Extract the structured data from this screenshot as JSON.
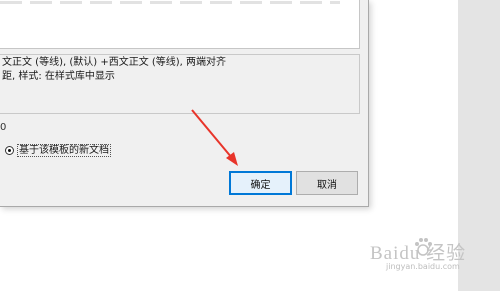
{
  "style_description": {
    "line1": "文正文 (等线), (默认) +西文正文 (等线), 两端对齐",
    "line2": "距, 样式: 在样式库中显示"
  },
  "options": {
    "partial_label": "0",
    "new_docs_radio_label": "基于该模板的新文档",
    "new_docs_radio_checked": true
  },
  "buttons": {
    "ok_label": "确定",
    "cancel_label": "取消"
  },
  "watermark": {
    "brand": "Baidu 经验",
    "url": "jingyan.baidu.com"
  },
  "colors": {
    "dialog_bg": "#f0f0f0",
    "focus_border": "#0078d7",
    "annotation_arrow": "#e8342a"
  }
}
